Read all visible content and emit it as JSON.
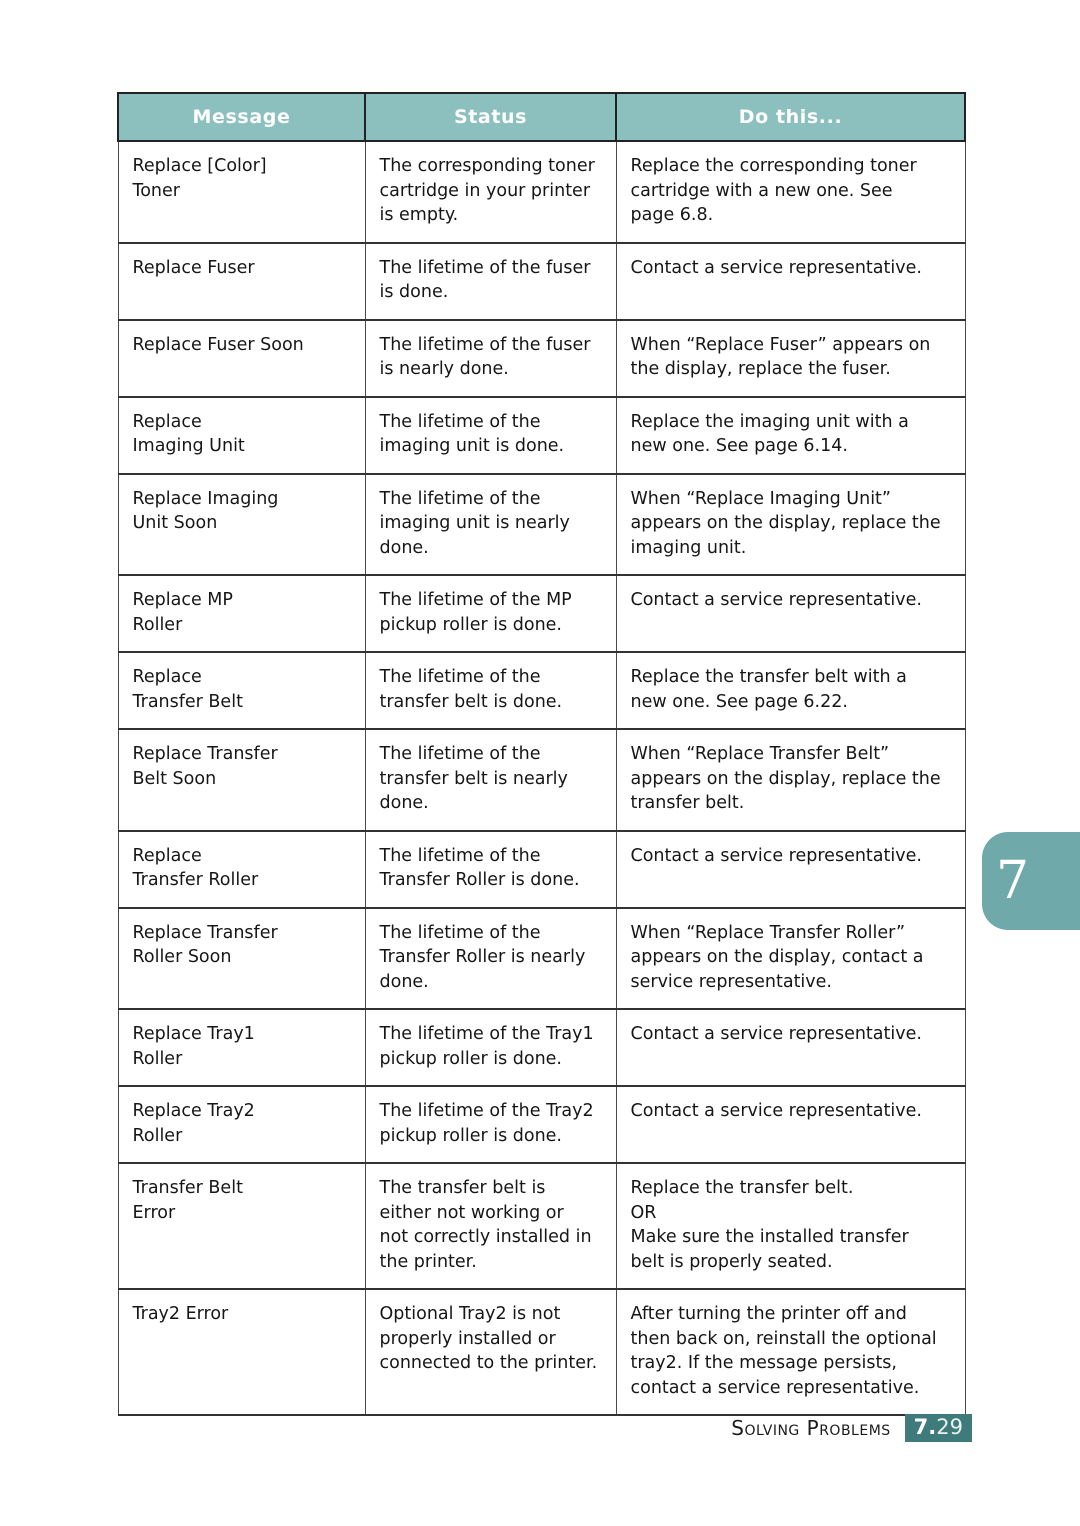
{
  "footer": {
    "title": "Solving Problems",
    "chapter": "7.",
    "page": "29"
  },
  "chapter_tab": {
    "number": "7"
  },
  "table": {
    "headers": [
      "Message",
      "Status",
      "Do this..."
    ],
    "rows": [
      {
        "message": "Replace [Color]\nToner",
        "status": "The corresponding toner\ncartridge in your printer\nis empty.",
        "action": "Replace the corresponding toner\ncartridge with a new one. See\npage 6.8."
      },
      {
        "message": "Replace Fuser",
        "status": "The lifetime of the fuser\nis done.",
        "action": "Contact a service representative."
      },
      {
        "message": "Replace Fuser Soon",
        "status": "The lifetime of the fuser\nis nearly done.",
        "action": "When “Replace Fuser” appears on\nthe display, replace the fuser."
      },
      {
        "message": "Replace\nImaging Unit",
        "status": "The lifetime of the\nimaging unit is done.",
        "action": "Replace the imaging unit with a\nnew one. See page 6.14."
      },
      {
        "message": "Replace Imaging\nUnit Soon",
        "status": "The lifetime of the\nimaging unit is nearly\ndone.",
        "action": "When “Replace Imaging Unit”\nappears on the display, replace the\nimaging unit."
      },
      {
        "message": "Replace MP\nRoller",
        "status": "The lifetime of the MP\npickup roller is done.",
        "action": "Contact a service representative."
      },
      {
        "message": "Replace\nTransfer Belt",
        "status": "The lifetime of the\ntransfer belt is done.",
        "action": "Replace the transfer belt with a\nnew one. See page 6.22."
      },
      {
        "message": "Replace Transfer\nBelt Soon",
        "status": "The lifetime of the\ntransfer belt is nearly\ndone.",
        "action": "When “Replace Transfer Belt”\nappears on the display, replace the\ntransfer belt."
      },
      {
        "message": "Replace\nTransfer Roller",
        "status": "The lifetime of the\nTransfer Roller is done.",
        "action": "Contact a service representative."
      },
      {
        "message": "Replace Transfer\nRoller Soon",
        "status": "The lifetime of the\nTransfer Roller is nearly\ndone.",
        "action": "When “Replace Transfer Roller”\nappears on the display, contact a\nservice representative."
      },
      {
        "message": "Replace Tray1\nRoller",
        "status": "The lifetime of the Tray1\npickup roller is done.",
        "action": "Contact a service representative."
      },
      {
        "message": "Replace Tray2\nRoller",
        "status": "The lifetime of the Tray2\npickup roller is done.",
        "action": "Contact a service representative."
      },
      {
        "message": "Transfer Belt\nError",
        "status": "The transfer belt is\neither not working or\nnot correctly installed in\nthe printer.",
        "action": "Replace the transfer belt.\nOR\nMake sure the installed transfer\nbelt is properly seated."
      },
      {
        "message": "Tray2 Error",
        "status": "Optional Tray2 is not\nproperly installed or\nconnected to the printer.",
        "action": "After turning the printer off and\nthen back on, reinstall the optional\ntray2. If the message persists,\ncontact a service representative."
      }
    ]
  },
  "colors": {
    "header_teal": "#8CC0BF",
    "tab_teal": "#6FA9A9",
    "badge_teal": "#3F7B7B"
  }
}
